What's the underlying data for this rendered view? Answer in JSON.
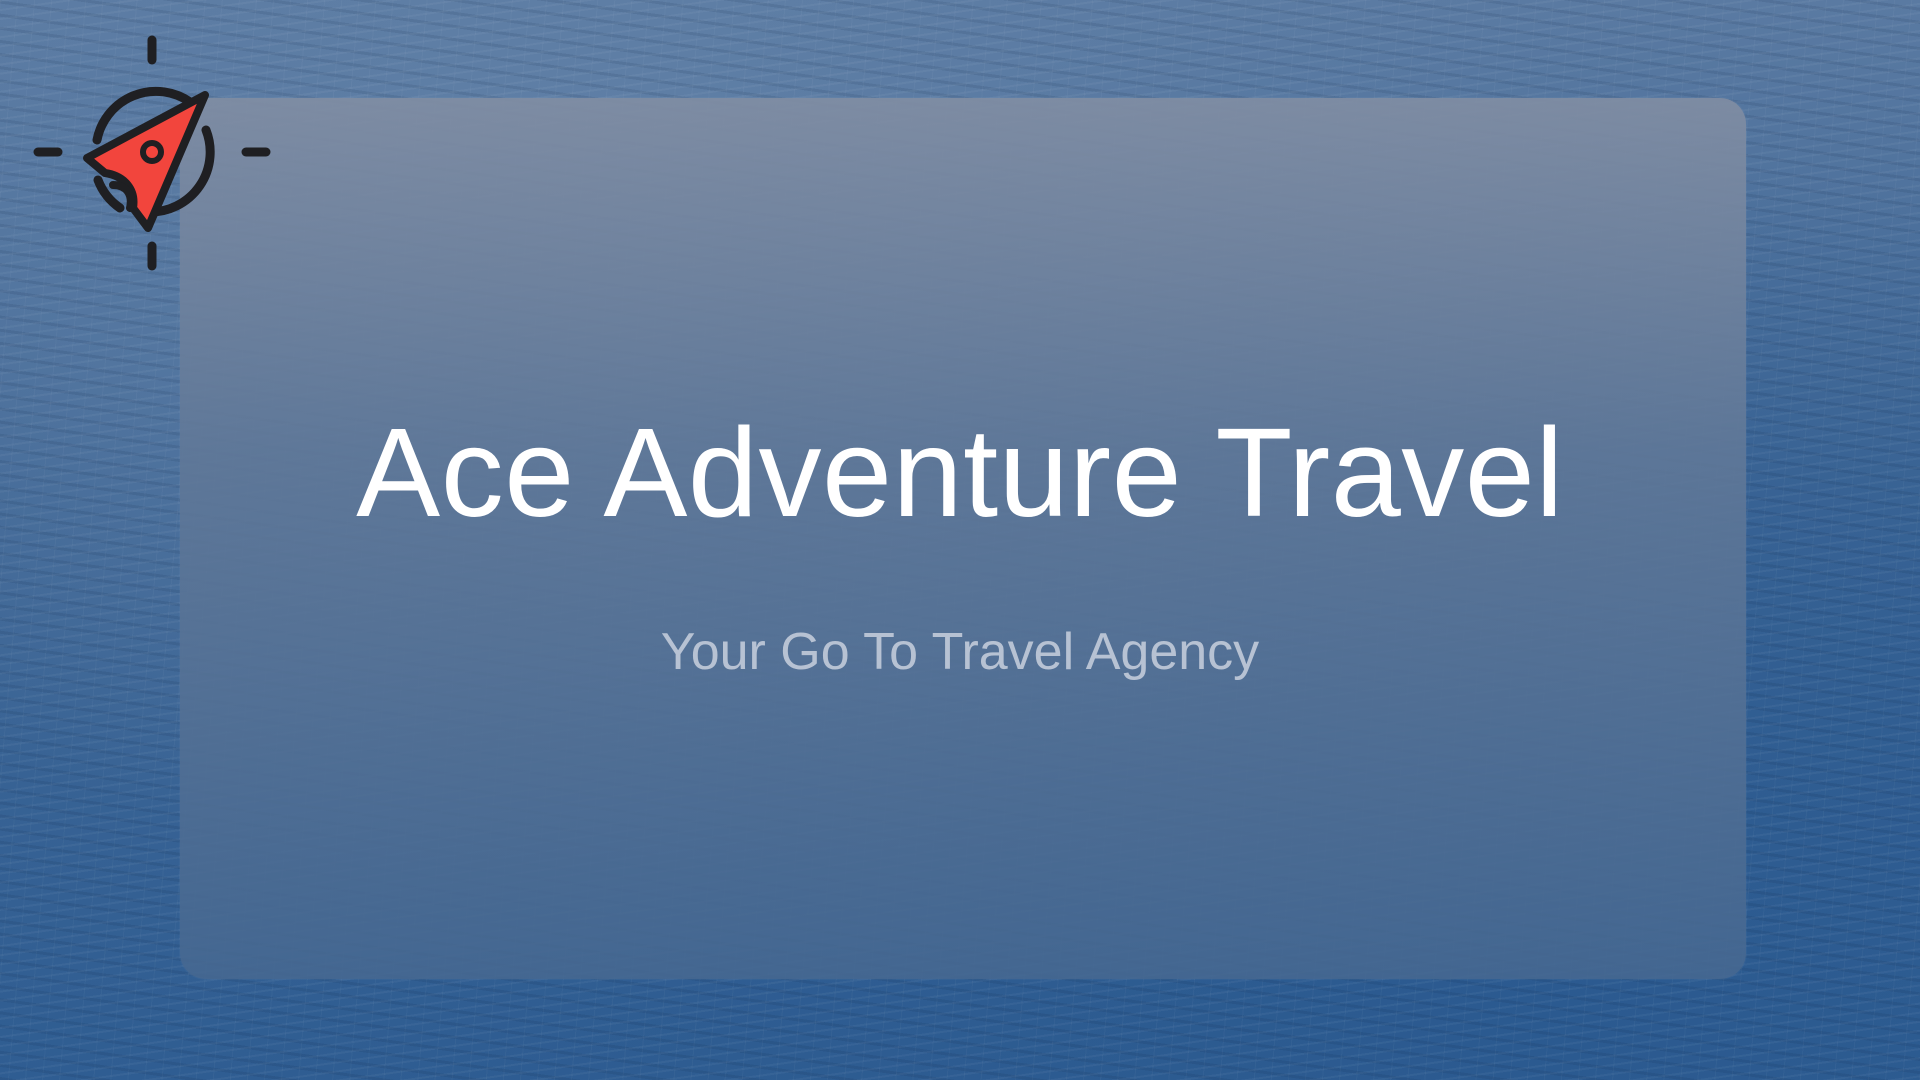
{
  "slide": {
    "title": "Ace Adventure Travel",
    "subtitle": "Your Go To Travel Agency"
  },
  "logo": {
    "icon": "compass-rocket-icon",
    "accent_color": "#f2453d",
    "outline_color": "#1f1f22"
  },
  "colors": {
    "background": "#3f6796",
    "card": "#6e7f99",
    "title_text": "#ffffff",
    "subtitle_text": "#b7c2d3"
  }
}
